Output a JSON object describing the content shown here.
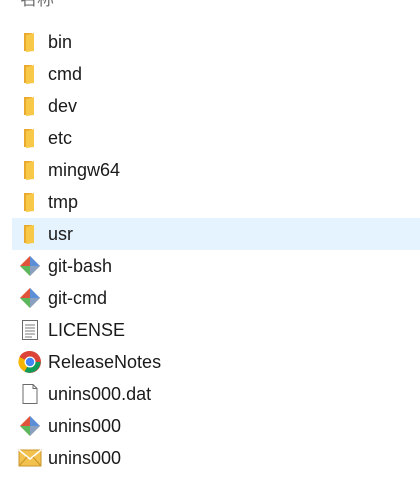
{
  "column_header": "名称",
  "items": [
    {
      "name": "bin",
      "icon": "folder-icon",
      "selected": false
    },
    {
      "name": "cmd",
      "icon": "folder-icon",
      "selected": false
    },
    {
      "name": "dev",
      "icon": "folder-icon",
      "selected": false
    },
    {
      "name": "etc",
      "icon": "folder-icon",
      "selected": false
    },
    {
      "name": "mingw64",
      "icon": "folder-icon",
      "selected": false
    },
    {
      "name": "tmp",
      "icon": "folder-icon",
      "selected": false
    },
    {
      "name": "usr",
      "icon": "folder-icon",
      "selected": true
    },
    {
      "name": "git-bash",
      "icon": "git-icon",
      "selected": false
    },
    {
      "name": "git-cmd",
      "icon": "git-icon",
      "selected": false
    },
    {
      "name": "LICENSE",
      "icon": "text-document-icon",
      "selected": false
    },
    {
      "name": "ReleaseNotes",
      "icon": "chrome-icon",
      "selected": false
    },
    {
      "name": "unins000.dat",
      "icon": "blank-file-icon",
      "selected": false
    },
    {
      "name": "unins000",
      "icon": "git-icon",
      "selected": false
    },
    {
      "name": "unins000",
      "icon": "mail-envelope-icon",
      "selected": false
    }
  ],
  "colors": {
    "folder": "#f8c848",
    "git_red": "#e0533a",
    "git_blue": "#5b8fd8",
    "git_green": "#5cb85c",
    "selection": "#e5f3ff",
    "envelope": "#f2c14e"
  }
}
